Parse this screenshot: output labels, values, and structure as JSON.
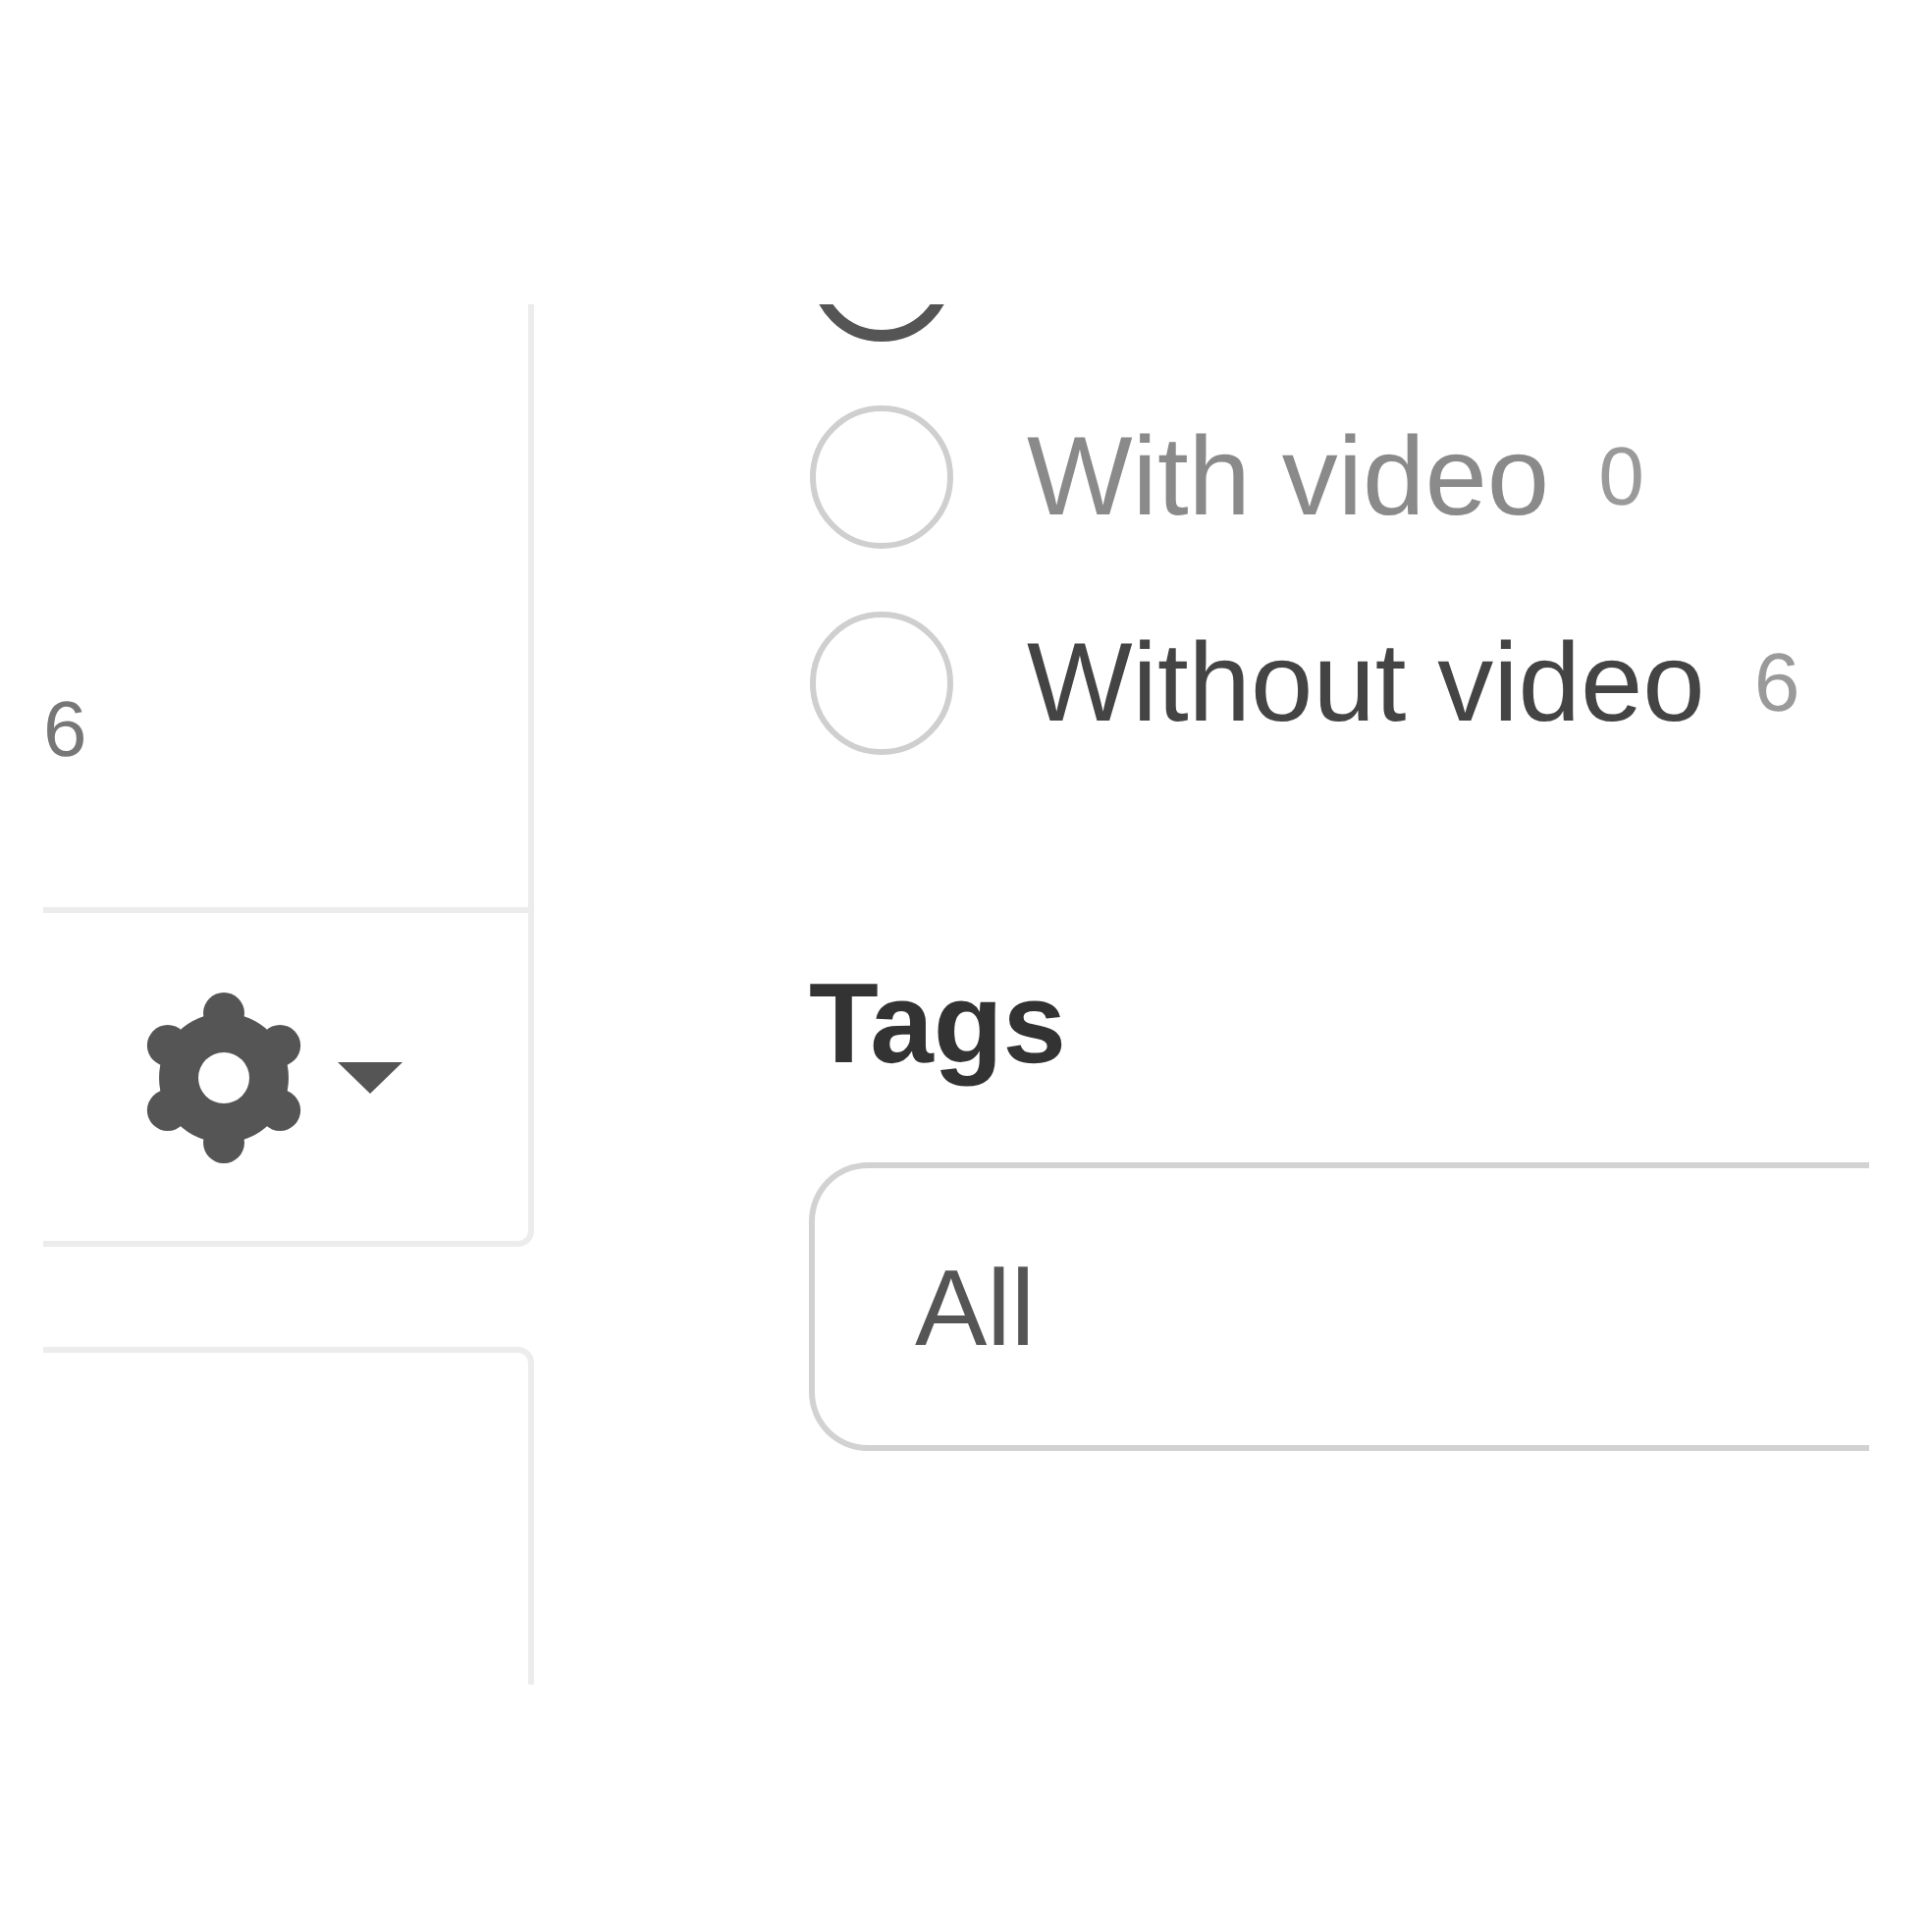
{
  "sidebar": {
    "count": "6"
  },
  "filters": {
    "video": {
      "options": [
        {
          "selected": true
        },
        {
          "label": "With video",
          "count": "0",
          "selected": false,
          "disabled": true
        },
        {
          "label": "Without video",
          "count": "6",
          "selected": false,
          "disabled": false
        }
      ]
    },
    "tags": {
      "title": "Tags",
      "value": "All"
    }
  }
}
